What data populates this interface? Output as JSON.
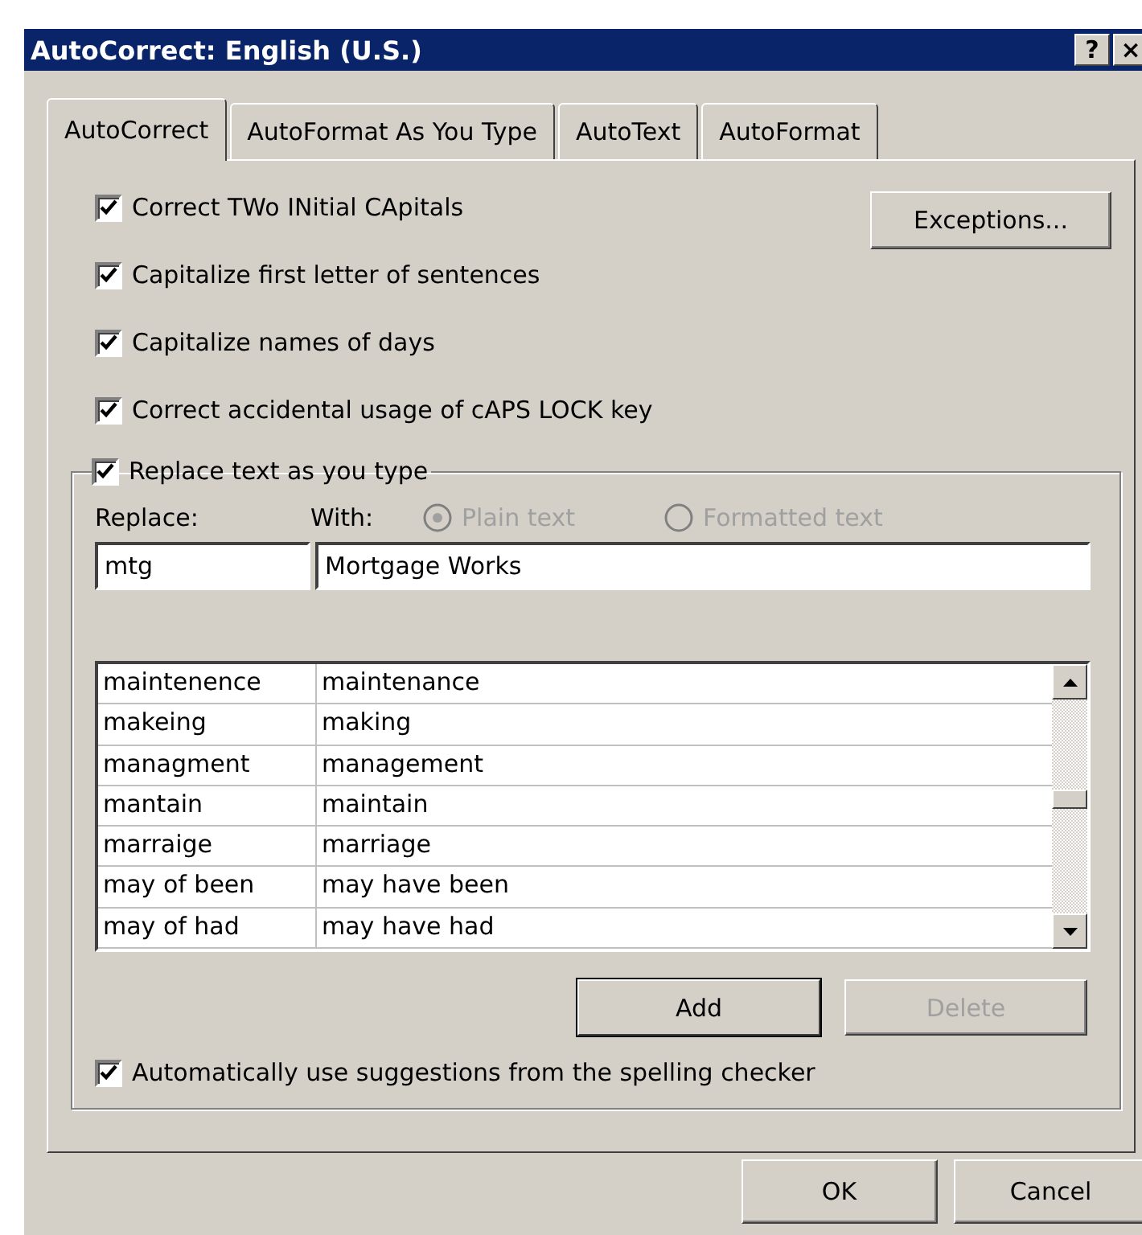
{
  "window": {
    "title": "AutoCorrect: English (U.S.)",
    "title_buttons": [
      "?",
      "×"
    ]
  },
  "tabs": [
    {
      "label": "AutoCorrect",
      "selected": true
    },
    {
      "label": "AutoFormat As You Type",
      "selected": false
    },
    {
      "label": "AutoText",
      "selected": false
    },
    {
      "label": "AutoFormat",
      "selected": false
    }
  ],
  "options": [
    {
      "label": "Correct TWo INitial CApitals",
      "checked": true
    },
    {
      "label": "Capitalize first letter of sentences",
      "checked": true
    },
    {
      "label": "Capitalize names of days",
      "checked": true
    },
    {
      "label": "Correct accidental usage of cAPS LOCK key",
      "checked": true
    }
  ],
  "exceptions_button": "Exceptions...",
  "replace_group": {
    "label": "Replace text as you type",
    "checked": true,
    "replace_label": "Replace:",
    "with_label": "With:",
    "format_options": [
      {
        "label": "Plain text",
        "selected": true,
        "disabled": true
      },
      {
        "label": "Formatted text",
        "selected": false,
        "disabled": true
      }
    ],
    "replace_value": "mtg",
    "with_value": "Mortgage Works",
    "entries": [
      {
        "replace": "maintenence",
        "with": "maintenance"
      },
      {
        "replace": "makeing",
        "with": "making"
      },
      {
        "replace": "managment",
        "with": "management"
      },
      {
        "replace": "mantain",
        "with": "maintain"
      },
      {
        "replace": "marraige",
        "with": "marriage"
      },
      {
        "replace": "may of been",
        "with": "may have been"
      },
      {
        "replace": "may of had",
        "with": "may have had"
      }
    ],
    "add_button": {
      "label": "Add",
      "disabled": false
    },
    "delete_button": {
      "label": "Delete",
      "disabled": true
    },
    "spelling": {
      "label": "Automatically use suggestions from the spelling checker",
      "checked": true
    }
  },
  "buttons": [
    "OK",
    "Cancel"
  ]
}
